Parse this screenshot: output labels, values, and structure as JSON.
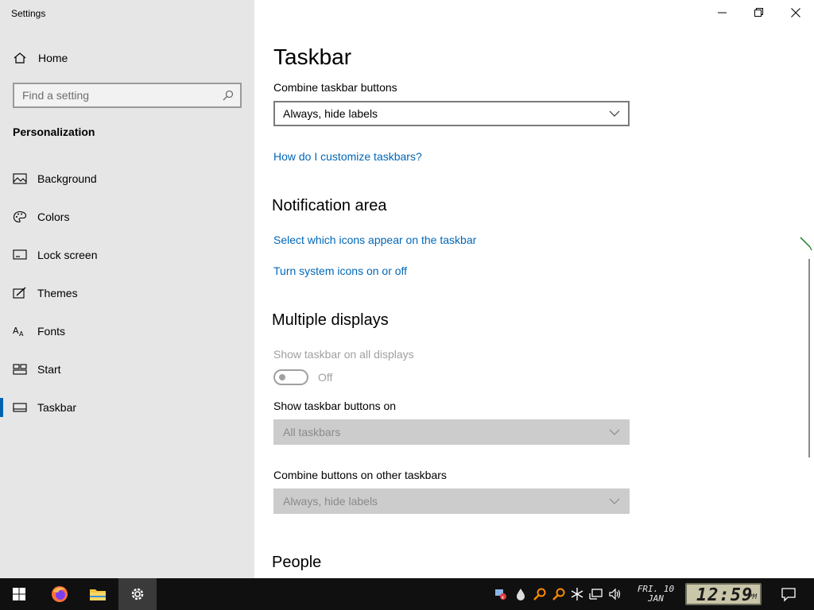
{
  "window": {
    "title": "Settings"
  },
  "sidebar": {
    "home_label": "Home",
    "search_placeholder": "Find a setting",
    "section_title": "Personalization",
    "items": [
      {
        "label": "Background",
        "icon": "picture-icon"
      },
      {
        "label": "Colors",
        "icon": "palette-icon"
      },
      {
        "label": "Lock screen",
        "icon": "lock-screen-icon"
      },
      {
        "label": "Themes",
        "icon": "themes-icon"
      },
      {
        "label": "Fonts",
        "icon": "fonts-icon"
      },
      {
        "label": "Start",
        "icon": "start-icon"
      },
      {
        "label": "Taskbar",
        "icon": "taskbar-icon",
        "active": true
      }
    ]
  },
  "main": {
    "page_title": "Taskbar",
    "combine_label": "Combine taskbar buttons",
    "combine_value": "Always, hide labels",
    "customize_link": "How do I customize taskbars?",
    "notification_heading": "Notification area",
    "select_icons_link": "Select which icons appear on the taskbar",
    "system_icons_link": "Turn system icons on or off",
    "multiple_displays_heading": "Multiple displays",
    "show_all_displays_label": "Show taskbar on all displays",
    "show_all_displays_state": "Off",
    "show_buttons_on_label": "Show taskbar buttons on",
    "show_buttons_on_value": "All taskbars",
    "combine_other_label": "Combine buttons on other taskbars",
    "combine_other_value": "Always, hide labels",
    "people_heading": "People"
  },
  "taskbar": {
    "date_line1": "FRI. 10",
    "date_line2": "JAN",
    "time": "12:59",
    "ampm": "PM"
  },
  "colors": {
    "accent": "#0063b1",
    "link": "#0067b8",
    "sidebar_bg": "#e6e6e6",
    "taskbar_bg": "#101010"
  }
}
